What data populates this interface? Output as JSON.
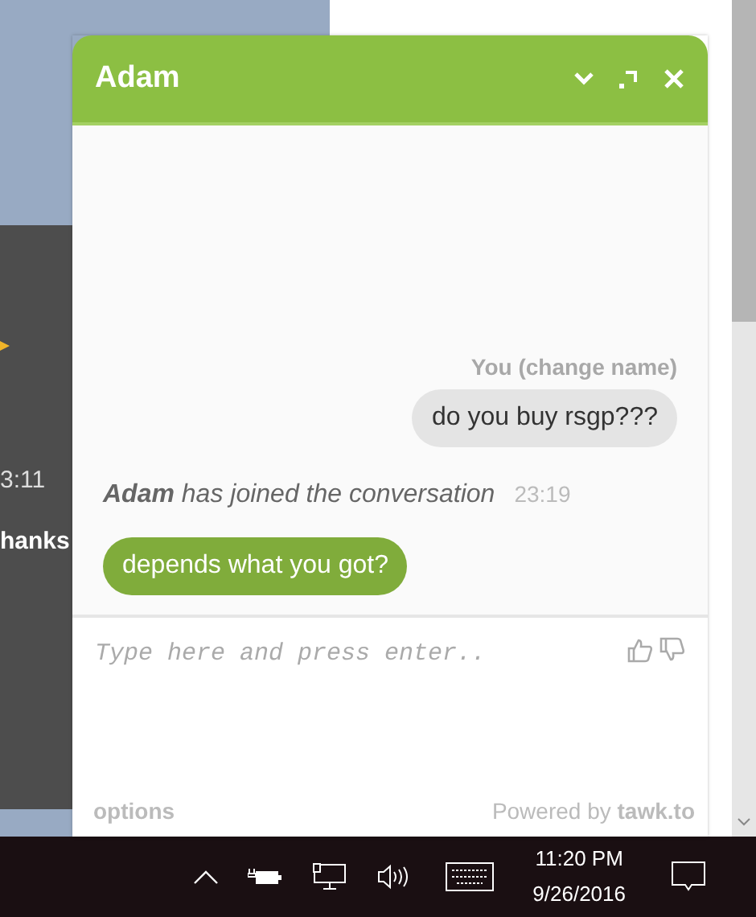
{
  "background_page": {
    "texts": [
      {
        "kind": "time",
        "text": "3:11"
      },
      {
        "kind": "bold",
        "text": "hanks"
      }
    ]
  },
  "chat": {
    "title": "Adam",
    "messages": [
      {
        "kind": "visitor",
        "sender": "You (change name)",
        "text": "do you buy rsgp???"
      },
      {
        "kind": "event",
        "text": "**Adam** has joined the conversation",
        "time": "23:19"
      },
      {
        "kind": "agent",
        "text": "depends what you got?"
      }
    ],
    "input": {
      "placeholder": "Type here and press enter.."
    },
    "footer": {
      "options": "options",
      "powered_by": "Powered by **tawk.to**"
    }
  },
  "taskbar": {
    "time": "11:20 PM",
    "date": "9/26/2016"
  }
}
